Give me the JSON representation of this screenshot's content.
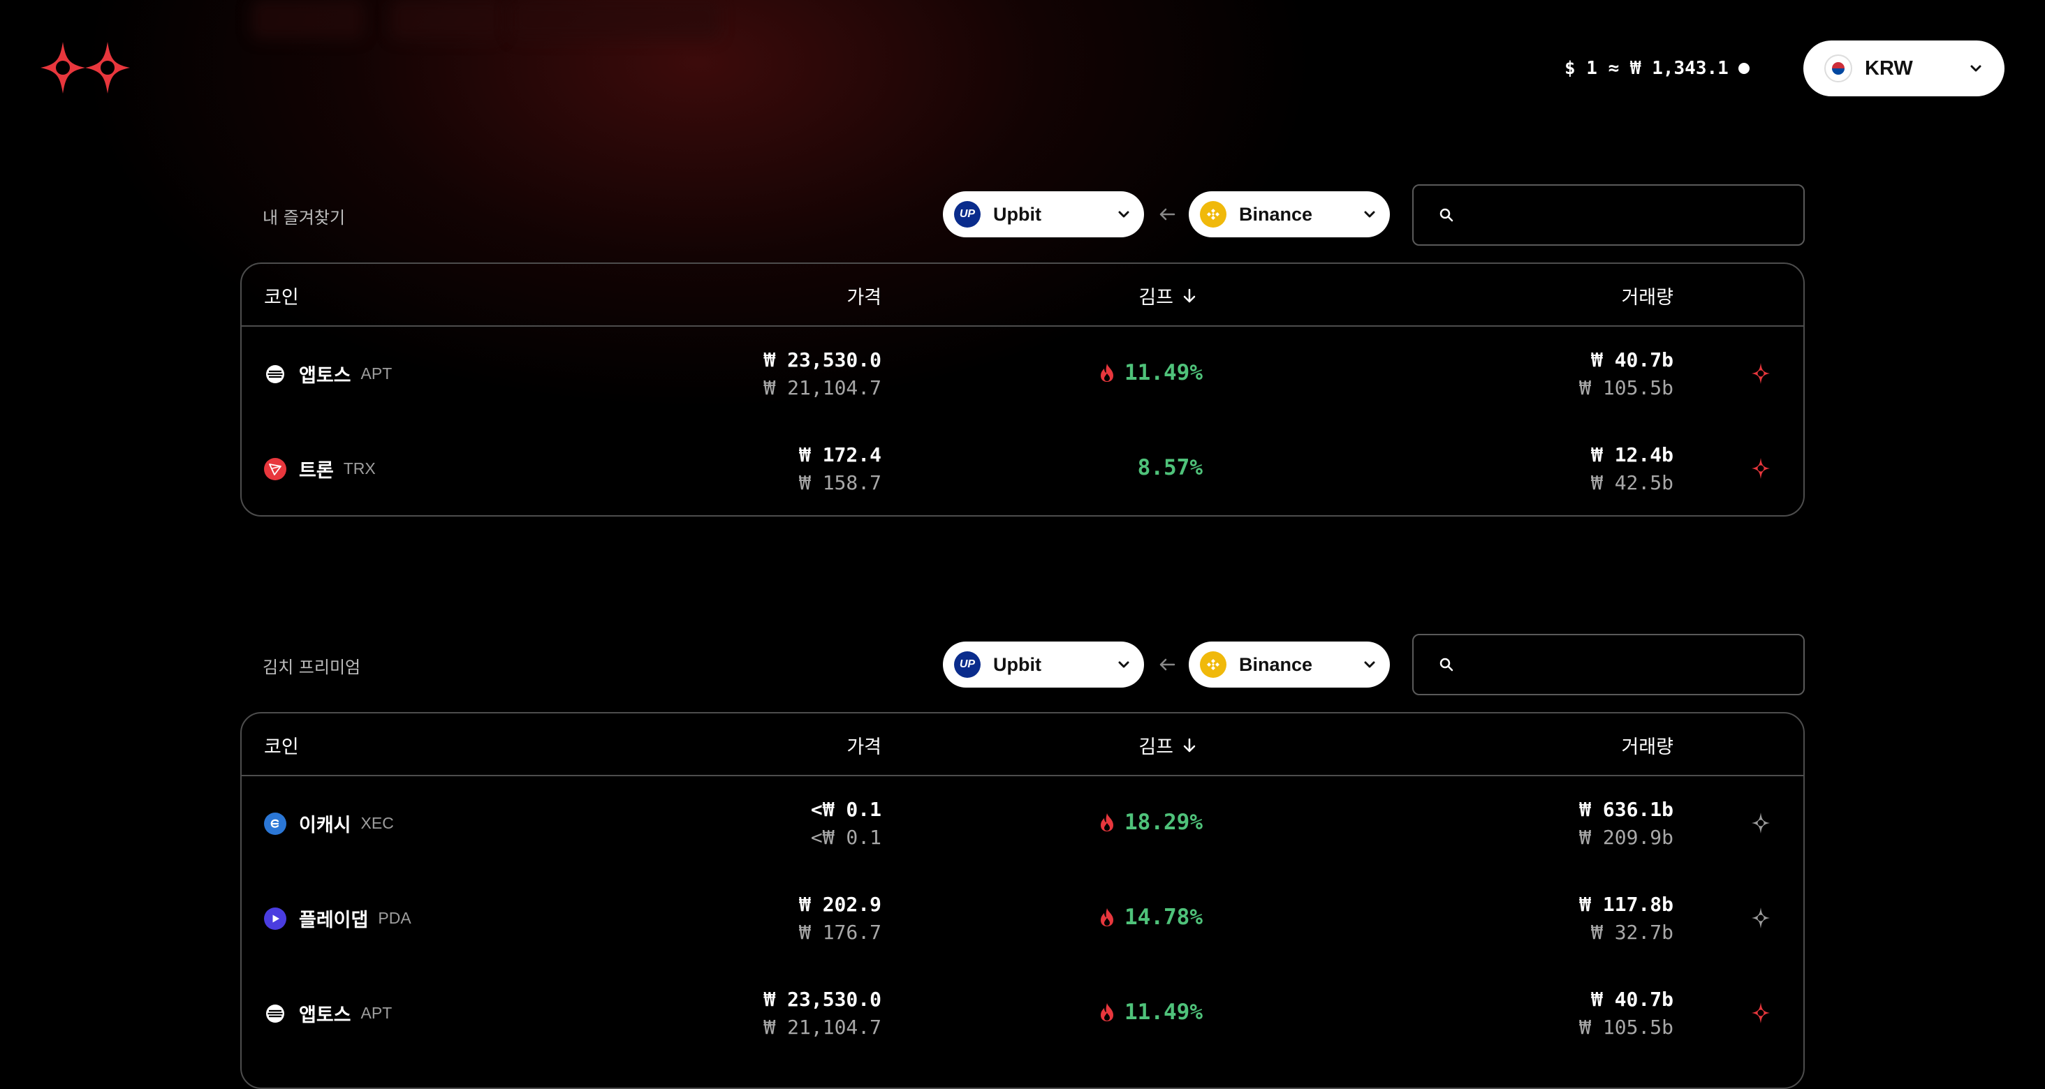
{
  "header": {
    "rate_text": "$ 1 ≈ ₩ 1,343.1",
    "currency": "KRW"
  },
  "favorites": {
    "title": "내 즐겨찾기",
    "target_exchange": "Upbit",
    "source_exchange": "Binance",
    "search_placeholder": "",
    "columns": {
      "coin": "코인",
      "price": "가격",
      "kimp": "김프",
      "volume": "거래량"
    },
    "rows": [
      {
        "name": "앱토스",
        "symbol": "APT",
        "price_main": "₩ 23,530.0",
        "price_sub": "₩ 21,104.7",
        "kimp": "11.49%",
        "volume_main": "₩ 40.7b",
        "volume_sub": "₩ 105.5b"
      },
      {
        "name": "트론",
        "symbol": "TRX",
        "price_main": "₩ 172.4",
        "price_sub": "₩ 158.7",
        "kimp": "8.57%",
        "volume_main": "₩ 12.4b",
        "volume_sub": "₩ 42.5b"
      }
    ]
  },
  "kimchi": {
    "title": "김치 프리미엄",
    "target_exchange": "Upbit",
    "source_exchange": "Binance",
    "search_placeholder": "",
    "columns": {
      "coin": "코인",
      "price": "가격",
      "kimp": "김프",
      "volume": "거래량"
    },
    "rows": [
      {
        "name": "이캐시",
        "symbol": "XEC",
        "price_main": "<₩ 0.1",
        "price_sub": "<₩ 0.1",
        "kimp": "18.29%",
        "volume_main": "₩ 636.1b",
        "volume_sub": "₩ 209.9b"
      },
      {
        "name": "플레이댑",
        "symbol": "PDA",
        "price_main": "₩ 202.9",
        "price_sub": "₩ 176.7",
        "kimp": "14.78%",
        "volume_main": "₩ 117.8b",
        "volume_sub": "₩ 32.7b"
      },
      {
        "name": "앱토스",
        "symbol": "APT",
        "price_main": "₩ 23,530.0",
        "price_sub": "₩ 21,104.7",
        "kimp": "11.49%",
        "volume_main": "₩ 40.7b",
        "volume_sub": "₩ 105.5b"
      }
    ]
  },
  "colors": {
    "accent_red": "#e8373d",
    "kimp_green": "#4fc27a",
    "background": "#000000"
  },
  "icons": [
    "logo-icon",
    "chevron-down-icon",
    "arrow-left-icon",
    "search-icon",
    "fire-icon",
    "star-icon",
    "flag-kr-icon"
  ]
}
